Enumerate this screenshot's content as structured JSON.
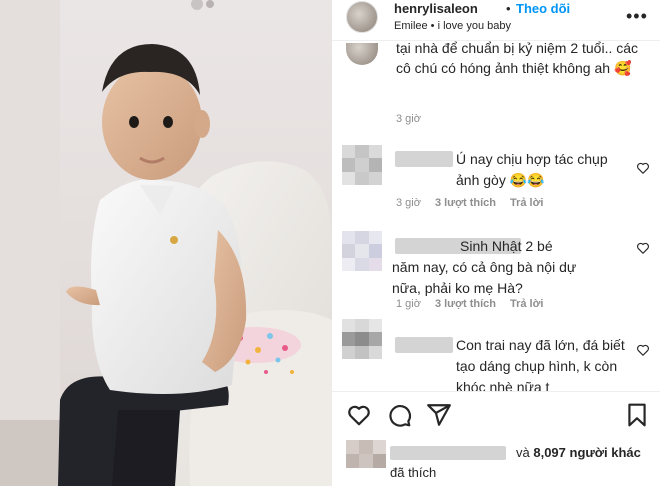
{
  "post": {
    "username": "henrylisaleon",
    "separator": "•",
    "follow_label": "Theo dõi",
    "subtitle": "Emilee • i love you baby",
    "more_icon": "more-horizontal-icon"
  },
  "caption": {
    "text": "tại nhà để chuẩn bị kỷ niệm 2 tuổi.. các cô chú có hóng ảnh thiệt không ah 🥰",
    "time": "3 giờ"
  },
  "comments": [
    {
      "text": "Ú nay chịu hợp tác chụp ảnh gòy 😂😂",
      "time": "3 giờ",
      "likes": "3 lượt thích",
      "reply": "Trả lời"
    },
    {
      "text": "Sinh Nhật 2 bé năm nay, có cả ông bà nội dự nữa, phải ko mẹ Hà?",
      "time": "1 giờ",
      "likes": "3 lượt thích",
      "reply": "Trả lời"
    },
    {
      "text": "Con trai nay đã lớn, đá biết tạo dáng chụp hình, k còn khóc nhè nữa t",
      "time": "",
      "likes": "",
      "reply": ""
    }
  ],
  "actions": {
    "like_icon": "heart-icon",
    "comment_icon": "comment-icon",
    "share_icon": "share-icon",
    "save_icon": "bookmark-icon"
  },
  "likes": {
    "prefix": "và",
    "count": "8,097 người khác",
    "suffix": "đã thích"
  },
  "colors": {
    "follow": "#0095f6",
    "muted": "#8e8e8e",
    "text": "#262626"
  }
}
